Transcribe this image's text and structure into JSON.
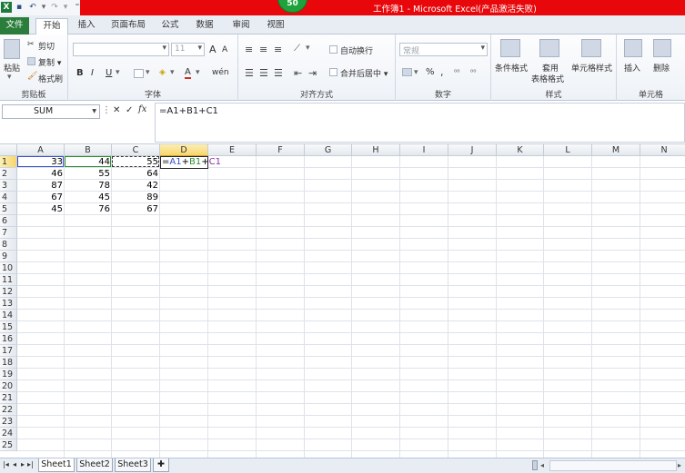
{
  "titlebar": {
    "title": "工作簿1 - Microsoft Excel(产品激活失败)",
    "badge": "50",
    "excel_icon": "X"
  },
  "tabs": [
    {
      "label": "文件"
    },
    {
      "label": "开始"
    },
    {
      "label": "插入"
    },
    {
      "label": "页面布局"
    },
    {
      "label": "公式"
    },
    {
      "label": "数据"
    },
    {
      "label": "审阅"
    },
    {
      "label": "视图"
    }
  ],
  "ribbon": {
    "clipboard": {
      "paste": "粘贴",
      "cut": "剪切",
      "copy": "复制 ▾",
      "format_painter": "格式刷",
      "label": "剪贴板"
    },
    "font": {
      "name": "",
      "size": "11",
      "grow": "A",
      "shrink": "A",
      "bold": "B",
      "italic": "I",
      "underline": "U",
      "label": "字体",
      "phonetic": "wén"
    },
    "alignment": {
      "wrap": "自动换行",
      "merge": "合并后居中 ▾",
      "label": "对齐方式"
    },
    "number": {
      "format": "常规",
      "pct": "%",
      "comma": ",",
      "label": "数字"
    },
    "styles": {
      "conditional": "条件格式",
      "table1": "套用",
      "table2": "表格格式",
      "cell_styles": "单元格样式",
      "label": "样式"
    },
    "cells": {
      "insert": "插入",
      "delete": "删除",
      "label": "单元格"
    }
  },
  "formula_bar": {
    "name_box": "SUM",
    "cancel": "✕",
    "enter": "✓",
    "fx": "fx",
    "content": "=A1+B1+C1"
  },
  "grid": {
    "columns": [
      "A",
      "B",
      "C",
      "D",
      "E",
      "F",
      "G",
      "H",
      "I",
      "J",
      "K",
      "L",
      "M",
      "N"
    ],
    "rows": [
      "1",
      "2",
      "3",
      "4",
      "5",
      "6",
      "7",
      "8",
      "9",
      "10",
      "11",
      "12",
      "13",
      "14",
      "15",
      "16",
      "17",
      "18",
      "19",
      "20",
      "21",
      "22",
      "23",
      "24",
      "25"
    ],
    "values": [
      [
        "33",
        "44",
        "55"
      ],
      [
        "46",
        "55",
        "64"
      ],
      [
        "87",
        "78",
        "42"
      ],
      [
        "67",
        "45",
        "89"
      ],
      [
        "45",
        "76",
        "67"
      ]
    ],
    "editing_cell": {
      "formula_parts": [
        "=",
        "A1",
        "+",
        "B1",
        "+",
        "C1"
      ],
      "colors": {
        "a": "#3a4fd1",
        "b": "#2e8b2e",
        "c": "#8e2ea5",
        "op": "#000000"
      }
    }
  },
  "sheets": [
    {
      "label": "Sheet1"
    },
    {
      "label": "Sheet2"
    },
    {
      "label": "Sheet3"
    }
  ]
}
